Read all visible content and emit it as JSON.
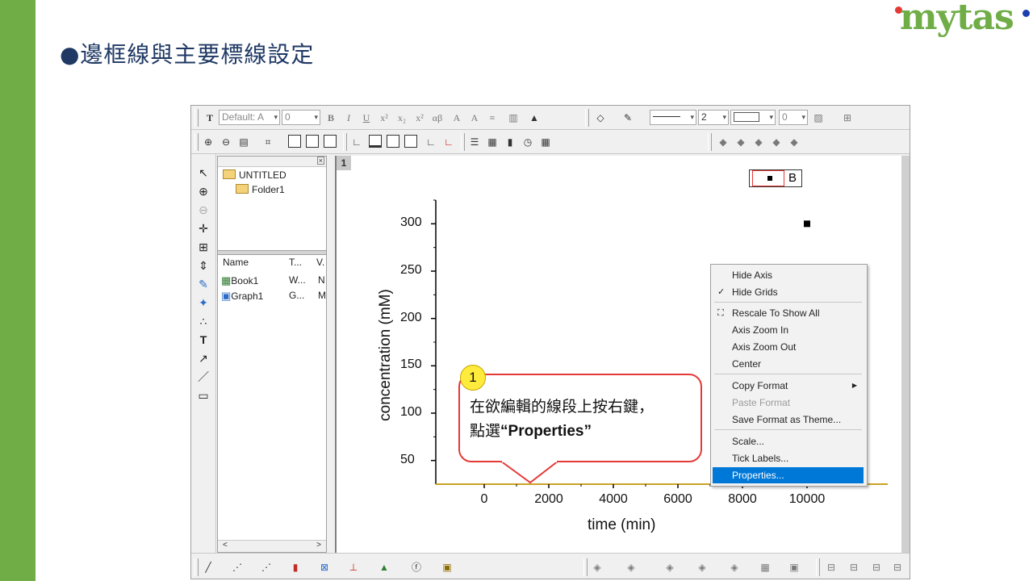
{
  "slide": {
    "title": "●邊框線與主要標線設定",
    "logo_text": "mytas",
    "brand_green": "#70AD47",
    "accent_red": "#E53935"
  },
  "toolbar1": {
    "font_name": "Default: A",
    "font_size": "0",
    "bold": "B",
    "italic": "I",
    "underline": "U",
    "line_width": "2",
    "border_size": "0"
  },
  "explorer": {
    "root": "UNTITLED",
    "folder": "Folder1",
    "columns": [
      "Name",
      "T...",
      "V."
    ],
    "rows": [
      {
        "name": "Book1",
        "type": "W...",
        "view": "N"
      },
      {
        "name": "Graph1",
        "type": "G...",
        "view": "M"
      }
    ],
    "scroll_left": "<",
    "scroll_right": ">"
  },
  "graph": {
    "page_number": "1",
    "legend_label": "B"
  },
  "chart_data": {
    "type": "scatter",
    "x": [
      10000
    ],
    "y": [
      300
    ],
    "xlabel": "time (min)",
    "ylabel": "concentration (mM)",
    "xlim": [
      -1500,
      12500
    ],
    "ylim": [
      25,
      325
    ],
    "x_ticks": [
      0,
      2000,
      4000,
      6000,
      8000,
      10000
    ],
    "y_ticks": [
      50,
      100,
      150,
      200,
      250,
      300
    ],
    "series": [
      {
        "name": "B",
        "marker": "square",
        "color": "#000000"
      }
    ],
    "legend_position": "top-right",
    "grid": false
  },
  "context_menu": {
    "items": [
      {
        "label": "Hide Axis"
      },
      {
        "label": "Hide Grids",
        "checked": true
      },
      {
        "label": "Rescale To Show All"
      },
      {
        "label": "Axis Zoom In"
      },
      {
        "label": "Axis Zoom Out"
      },
      {
        "label": "Center"
      },
      {
        "label": "Copy Format",
        "submenu": true
      },
      {
        "label": "Paste Format",
        "disabled": true
      },
      {
        "label": "Save Format as Theme..."
      },
      {
        "label": "Scale..."
      },
      {
        "label": "Tick Labels..."
      },
      {
        "label": "Properties...",
        "selected": true
      }
    ]
  },
  "callout": {
    "step": "1",
    "line1": "在欲編輯的線段上按右鍵，",
    "line2_prefix": "點選",
    "line2_bold": "“Properties”"
  }
}
